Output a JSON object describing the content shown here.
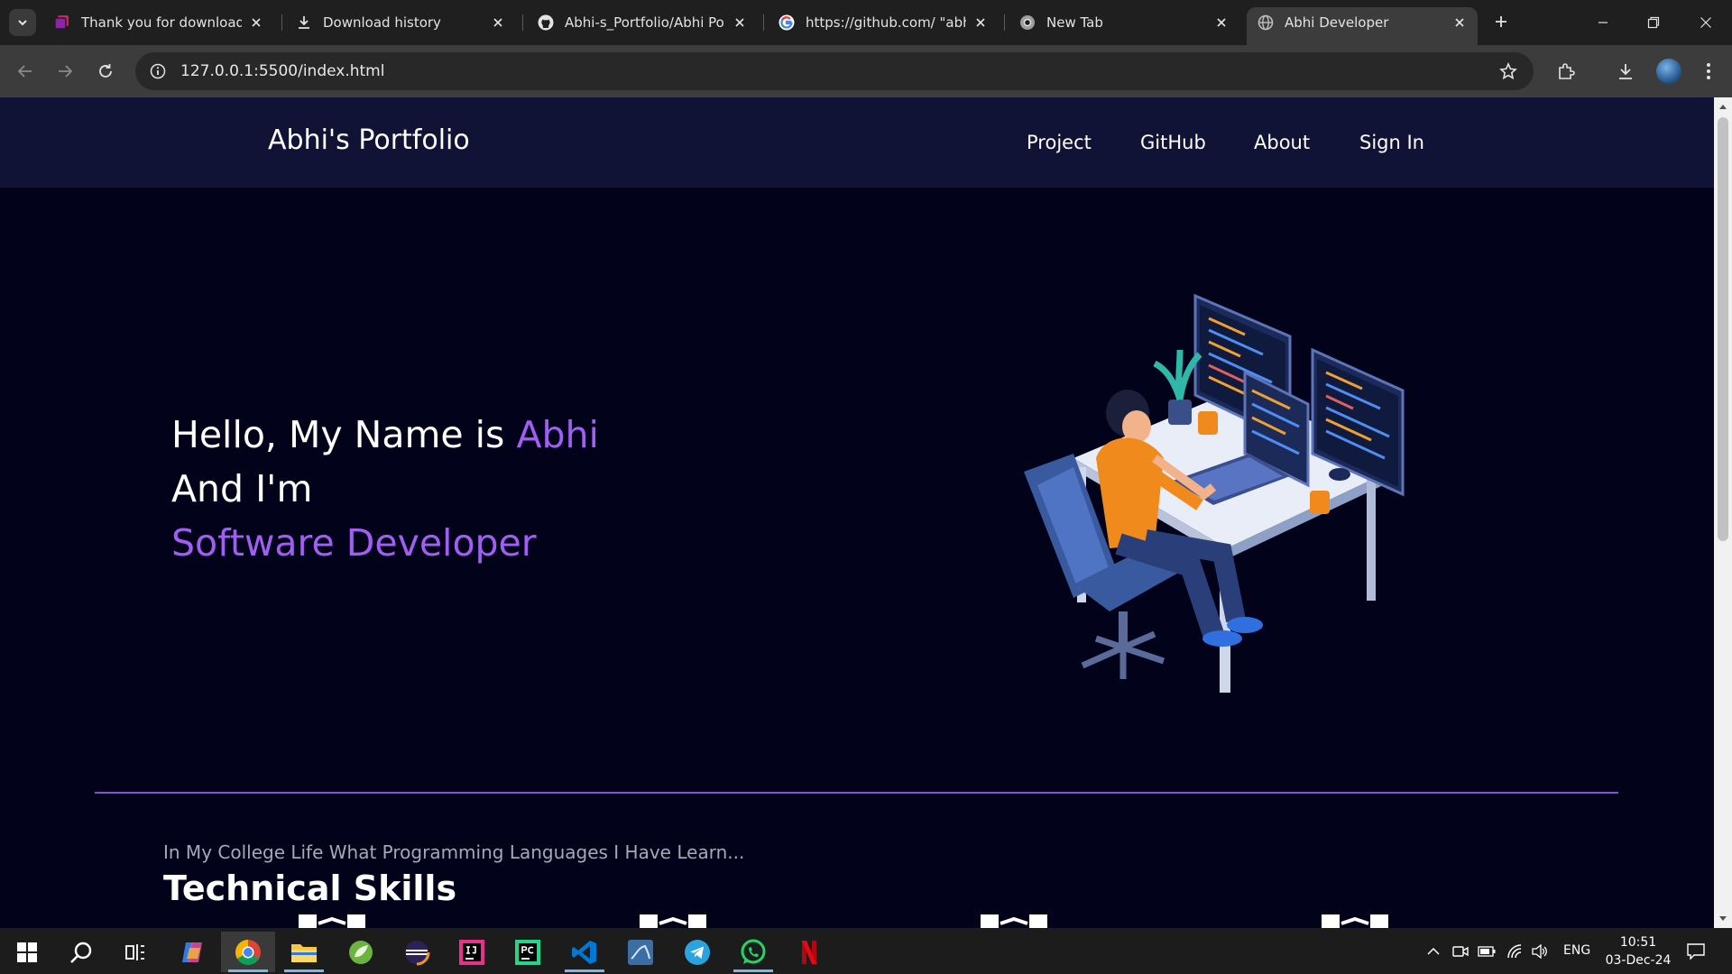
{
  "browser": {
    "tabs": [
      {
        "label": "Thank you for downloading",
        "icon": "stack-favicon-icon",
        "active": false
      },
      {
        "label": "Download history",
        "icon": "download-icon",
        "active": false
      },
      {
        "label": "Abhi-s_Portfolio/Abhi Portf",
        "icon": "github-icon",
        "active": false
      },
      {
        "label": "https://github.com/ \"abhiw",
        "icon": "google-icon",
        "active": false
      },
      {
        "label": "New Tab",
        "icon": "chrome-icon",
        "active": false
      },
      {
        "label": "Abhi Developer",
        "icon": "globe-icon",
        "active": true
      }
    ],
    "url": "127.0.0.1:5500/index.html"
  },
  "site": {
    "brand": "Abhi's Portfolio",
    "nav": [
      "Project",
      "GitHub",
      "About",
      "Sign In"
    ],
    "hero": {
      "greeting": "Hello, My Name is",
      "name": "Abhi",
      "line2": "And I'm",
      "role": "Software Developer"
    },
    "skills": {
      "subtitle": "In My College Life What Programming Languages I Have Learn...",
      "title": "Technical Skills"
    }
  },
  "taskbar": {
    "apps": [
      "windows-start-icon",
      "search-icon",
      "task-view-icon",
      "copilot-icon",
      "chrome-icon",
      "file-explorer-icon",
      "spring-tools-icon",
      "eclipse-icon",
      "intellij-icon",
      "pycharm-icon",
      "vscode-icon",
      "mysql-workbench-icon",
      "telegram-icon",
      "whatsapp-icon",
      "netflix-icon"
    ],
    "language": "ENG",
    "time": "10:51",
    "date": "03-Dec-24"
  },
  "colors": {
    "accent": "#a25ef2",
    "page_bg": "#02021a",
    "nav_bg": "#111336"
  }
}
